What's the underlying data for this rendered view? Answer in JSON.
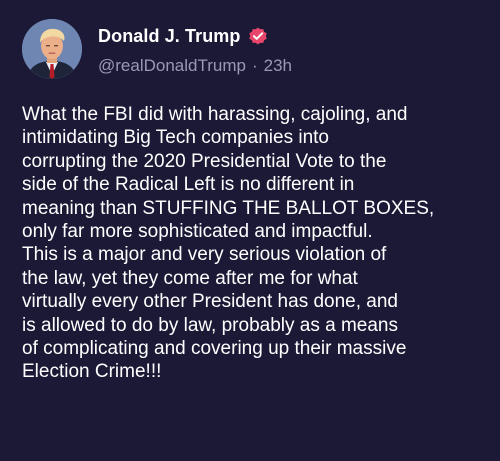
{
  "post": {
    "author": {
      "display_name": "Donald J. Trump",
      "handle": "@realDonaldTrump",
      "verified": true,
      "avatar_icon": "profile-photo"
    },
    "timestamp": "23h",
    "separator": "·",
    "text": "What the FBI did with harassing, cajoling, and\nintimidating Big Tech companies into\ncorrupting the 2020 Presidential Vote to the\nside of the Radical Left is no different in\nmeaning than STUFFING THE BALLOT BOXES,\nonly far more sophisticated and impactful.\nThis is a major and very serious violation of\nthe law, yet they come after me for what\nvirtually every other President has done, and\nis allowed to do by law, probably as a means\nof complicating and covering up their massive\nElection Crime!!!"
  },
  "colors": {
    "background": "#1c1936",
    "text": "#ffffff",
    "muted": "#9a98b3",
    "verified_badge": "#e8456b"
  }
}
